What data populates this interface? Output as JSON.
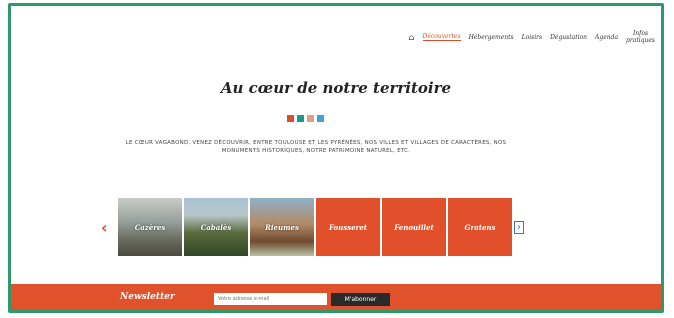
{
  "nav": {
    "home_icon": "home-icon",
    "items": [
      "Découvertes",
      "Hébergements",
      "Loisirs",
      "Dégustation",
      "Agenda"
    ],
    "infos_line1": "Infos",
    "infos_line2": "pratiques"
  },
  "hero": {
    "title": "Au cœur de notre territoire",
    "swatch_colors": [
      "#d94f2b",
      "#1f9a8a",
      "#d9a08a",
      "#3fa3d6"
    ],
    "intro": "Le cœur vagabond, venez découvrir, entre Toulouse et les Pyrénées, nos villes et villages de caractères, nos monuments historiques, notre patrimoine naturel, etc."
  },
  "carousel": {
    "prev_icon": "chevron-left-icon",
    "next_icon": "chevron-right-icon",
    "tiles": [
      "Cazères",
      "Cabalès",
      "Rieumes",
      "Fousseret",
      "Fenouillet",
      "Gratens"
    ]
  },
  "newsletter": {
    "label": "Newsletter",
    "placeholder": "Votre adresse e-mail",
    "button": "M'abonner"
  },
  "colors": {
    "accent": "#e0522c",
    "frame": "#2e9a6a"
  }
}
